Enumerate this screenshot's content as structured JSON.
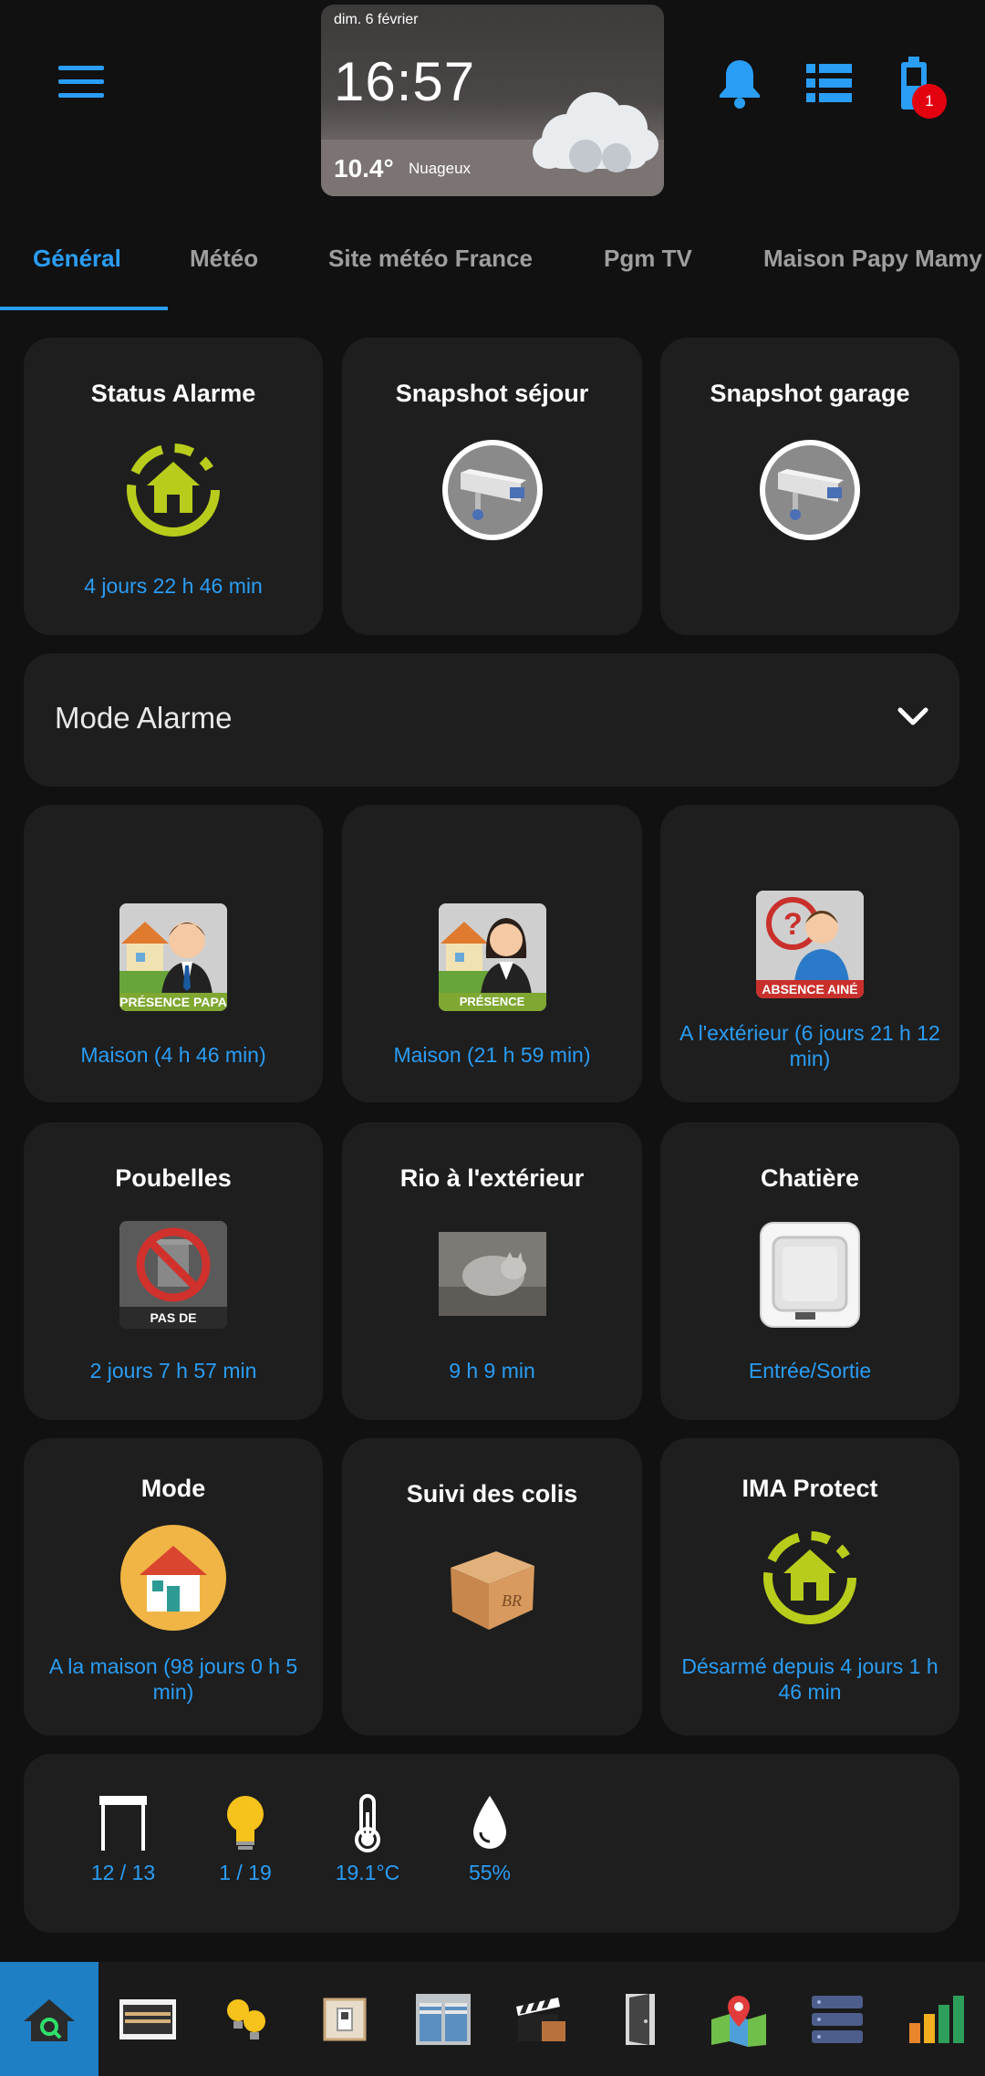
{
  "header": {
    "menu_icon": "hamburger-menu-icon",
    "notifications_icon": "bell-icon",
    "list_icon": "list-icon",
    "battery_icon": "battery-icon",
    "battery_badge": "1",
    "accent_color": "#2a9df4"
  },
  "weather": {
    "date": "dim. 6 février",
    "time": "16:57",
    "temperature": "10.4°",
    "condition": "Nuageux"
  },
  "tabs": [
    {
      "label": "Général",
      "active": true
    },
    {
      "label": "Météo"
    },
    {
      "label": "Site météo France"
    },
    {
      "label": "Pgm TV"
    },
    {
      "label": "Maison Papy Mamy"
    }
  ],
  "cards": {
    "status_alarme": {
      "title": "Status Alarme",
      "state": "4 jours 22 h 46 min",
      "icon": "alarm-house-icon"
    },
    "snapshot_sejour": {
      "title": "Snapshot séjour",
      "icon": "camera-icon"
    },
    "snapshot_garage": {
      "title": "Snapshot garage",
      "icon": "camera-icon"
    },
    "mode_alarme": {
      "label": "Mode Alarme",
      "icon": "chevron-down-icon"
    },
    "presence_papa": {
      "badge": "PRÉSENCE PAPA",
      "state": "Maison  (4 h 46 min)",
      "icon": "person-man-icon"
    },
    "presence_maman": {
      "badge": "PRÉSENCE MAMAN",
      "state": "Maison (21 h 59 min)",
      "icon": "person-woman-icon"
    },
    "absence_aine": {
      "badge": "ABSENCE AINÉ",
      "state": "A l'extérieur (6 jours 21 h 12 min)",
      "icon": "person-boy-icon"
    },
    "poubelles": {
      "title": "Poubelles",
      "badge": "PAS DE POUBELLE",
      "state": "2 jours 7 h 57 min",
      "icon": "no-trash-icon"
    },
    "rio": {
      "title": "Rio à l'extérieur",
      "state": "9 h 9 min",
      "icon": "cat-photo-icon"
    },
    "chatiere": {
      "title": "Chatière",
      "state": "Entrée/Sortie",
      "icon": "cat-flap-icon"
    },
    "mode": {
      "title": "Mode",
      "state": "A la maison (98 jours 0 h 5 min)",
      "icon": "home-icon"
    },
    "colis": {
      "title": "Suivi des colis",
      "icon": "package-icon"
    },
    "ima": {
      "title": "IMA Protect",
      "state": "Désarmé depuis 4 jours 1 h 46 min",
      "icon": "alarm-house-icon"
    }
  },
  "sensors": [
    {
      "icon": "shutter-icon",
      "value": "12 / 13"
    },
    {
      "icon": "light-bulb-icon",
      "value": "1 / 19"
    },
    {
      "icon": "thermometer-icon",
      "value": "19.1°C"
    },
    {
      "icon": "water-drop-icon",
      "value": "55%"
    }
  ],
  "bottom_nav": [
    {
      "icon": "home-search-icon",
      "active": true
    },
    {
      "icon": "blinds-icon"
    },
    {
      "icon": "light-bulbs-icon"
    },
    {
      "icon": "switch-icon"
    },
    {
      "icon": "shutters-icon"
    },
    {
      "icon": "clapperboard-icon"
    },
    {
      "icon": "door-icon"
    },
    {
      "icon": "map-icon"
    },
    {
      "icon": "server-icon"
    },
    {
      "icon": "bar-chart-icon"
    }
  ]
}
